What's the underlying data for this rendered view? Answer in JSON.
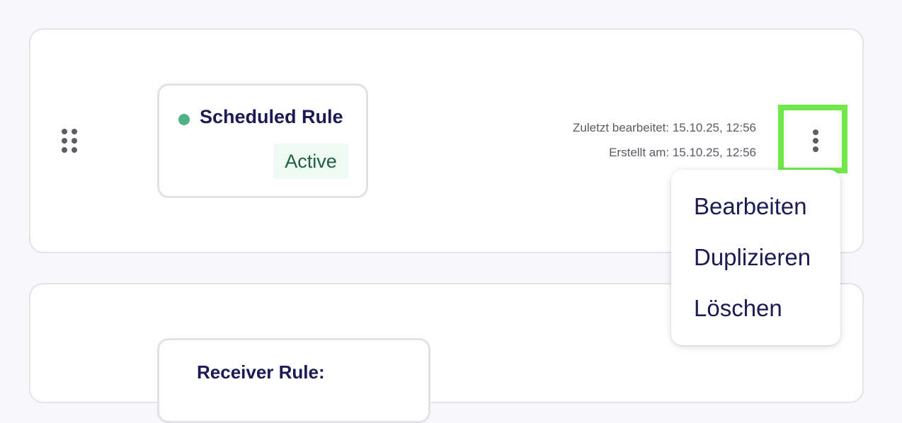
{
  "rules": [
    {
      "name": "Scheduled Rule",
      "status": "Active",
      "status_color": "#4fb287",
      "last_edited": "Zuletzt bearbeitet: 15.10.25, 12:56",
      "created": "Erstellt am: 15.10.25, 12:56"
    },
    {
      "name": "Receiver Rule:"
    }
  ],
  "context_menu": {
    "items": [
      "Bearbeiten",
      "Duplizieren",
      "Löschen"
    ]
  },
  "icons": {
    "drag_handle": "drag-handle-icon",
    "more": "more-vertical-icon"
  },
  "colors": {
    "accent_text": "#1c1a54",
    "active_badge_bg": "#eefaf3",
    "active_badge_text": "#20603f",
    "highlight_border": "#6fe94a"
  }
}
